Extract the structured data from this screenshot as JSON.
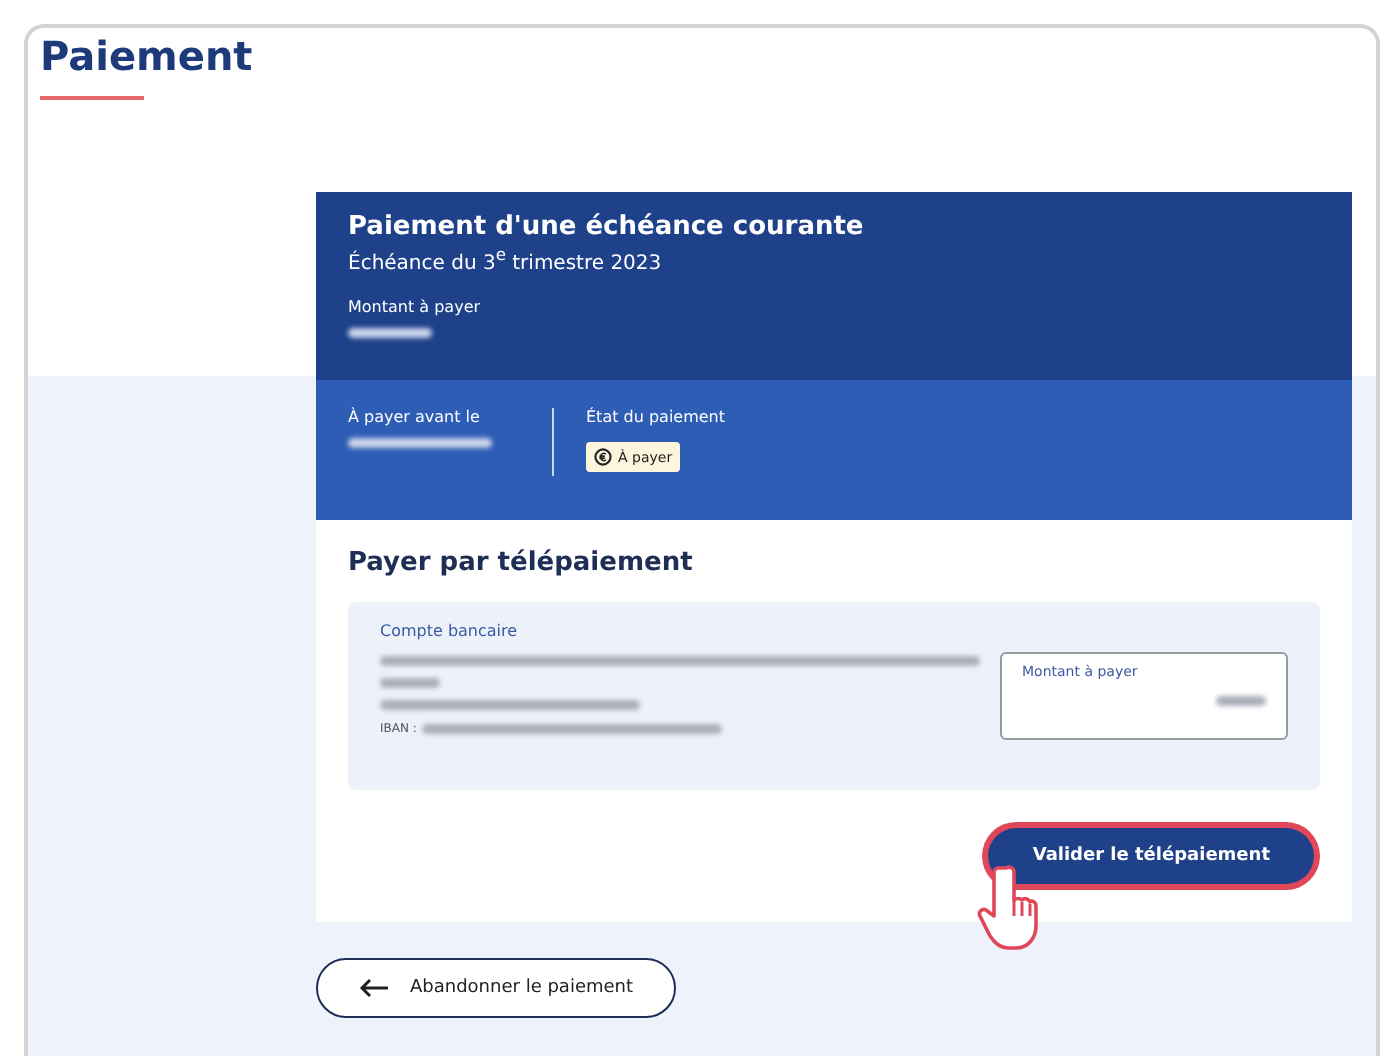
{
  "page": {
    "title": "Paiement"
  },
  "header": {
    "title": "Paiement d'une échéance courante",
    "subtitle": "Échéance du 3$^{e}$ trimestre 2023",
    "amount_label": "Montant à payer"
  },
  "info": {
    "due_label": "À payer avant le",
    "status_label": "État du paiement",
    "status_badge": "À payer"
  },
  "payment": {
    "title": "Payer par télépaiement",
    "account_label": "Compte bancaire",
    "iban_label": "IBAN :",
    "amount_field_label": "Montant à payer"
  },
  "submit_button": {
    "label": "Valider le télépaiement",
    "highlighted": true
  },
  "back_button": {
    "label": "Abandonner le paiement"
  }
}
